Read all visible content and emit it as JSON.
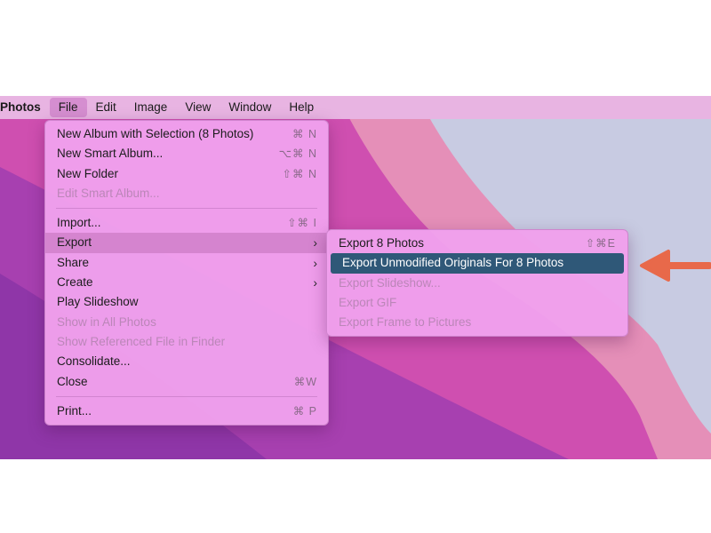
{
  "menubar": {
    "app": "Photos",
    "items": [
      "File",
      "Edit",
      "Image",
      "View",
      "Window",
      "Help"
    ]
  },
  "file_menu": {
    "new_album": {
      "label": "New Album with Selection (8 Photos)",
      "shortcut": "⌘ N"
    },
    "new_smart_album": {
      "label": "New Smart Album...",
      "shortcut": "⌥⌘ N"
    },
    "new_folder": {
      "label": "New Folder",
      "shortcut": "⇧⌘ N"
    },
    "edit_smart_album": {
      "label": "Edit Smart Album..."
    },
    "import": {
      "label": "Import...",
      "shortcut": "⇧⌘ I"
    },
    "export": {
      "label": "Export"
    },
    "share": {
      "label": "Share"
    },
    "create": {
      "label": "Create"
    },
    "play_slideshow": {
      "label": "Play Slideshow"
    },
    "show_in_all_photos": {
      "label": "Show in All Photos"
    },
    "show_referenced": {
      "label": "Show Referenced File in Finder"
    },
    "consolidate": {
      "label": "Consolidate..."
    },
    "close": {
      "label": "Close",
      "shortcut": "⌘W"
    },
    "print": {
      "label": "Print...",
      "shortcut": "⌘ P"
    }
  },
  "export_menu": {
    "export_photos": {
      "label": "Export 8 Photos",
      "shortcut": "⇧⌘E"
    },
    "export_unmodified": {
      "label": "Export Unmodified Originals For 8 Photos"
    },
    "export_slideshow": {
      "label": "Export Slideshow..."
    },
    "export_gif": {
      "label": "Export GIF"
    },
    "export_frame": {
      "label": "Export Frame to Pictures"
    }
  },
  "submenu_arrow": "›",
  "colors": {
    "highlight": "#2f5878",
    "annotation_arrow": "#e8694a",
    "menu_bg": "#f0a0ec"
  }
}
